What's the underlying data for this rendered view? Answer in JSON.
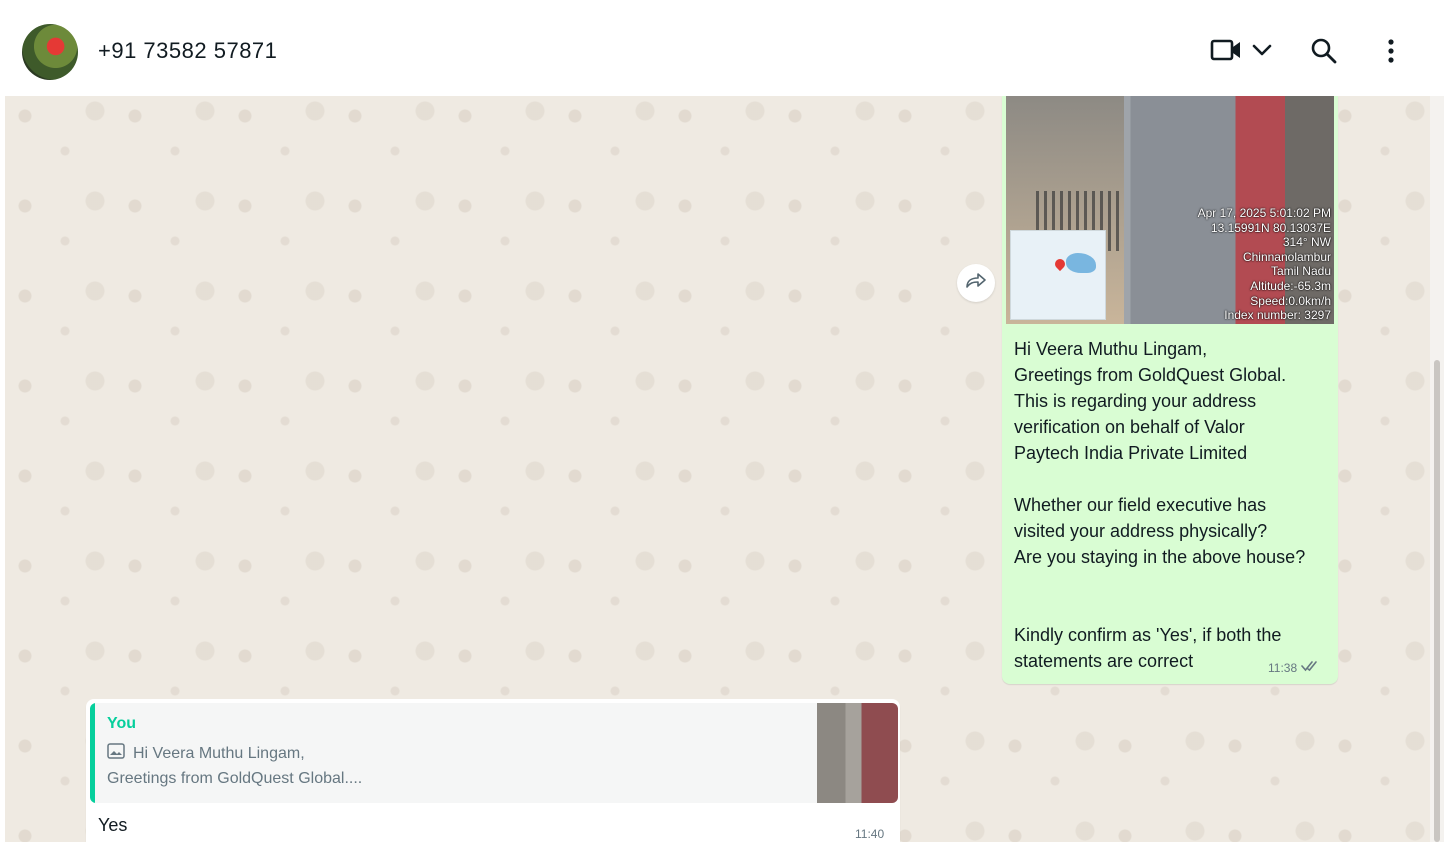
{
  "header": {
    "contact_name": "+91 73582 57871",
    "icons": [
      "video-call-icon",
      "chevron-down-icon",
      "search-icon",
      "menu-icon"
    ]
  },
  "messages": {
    "outgoing": {
      "image_stamp": [
        "Apr 17, 2025 5:01:02 PM",
        "13.15991N 80.13037E",
        "314° NW",
        "Chinnanolambur",
        "Tamil Nadu",
        "Altitude:-65.3m",
        "Speed:0.0km/h",
        "Index number: 3297"
      ],
      "text_lines_a": [
        "Hi Veera Muthu Lingam,",
        "Greetings from GoldQuest Global.",
        "This is regarding your address",
        "verification on behalf of Valor",
        "Paytech India Private Limited"
      ],
      "text_lines_b": [
        "Whether our field executive has",
        "visited your address physically?",
        "Are you staying in the above house?"
      ],
      "text_lines_c": [
        "Kindly confirm as 'Yes', if both the",
        "statements are correct"
      ],
      "time": "11:38",
      "status": "read"
    },
    "incoming": {
      "quote_author": "You",
      "quote_line1": "Hi Veera Muthu Lingam,",
      "quote_line2": "Greetings from GoldQuest Global....",
      "text": "Yes",
      "time": "11:40"
    }
  },
  "colors": {
    "outgoing_bubble": "#d9fdd3",
    "chat_background": "#efeae2",
    "quote_accent": "#06cf9c",
    "read_ticks": "#53bdeb"
  }
}
